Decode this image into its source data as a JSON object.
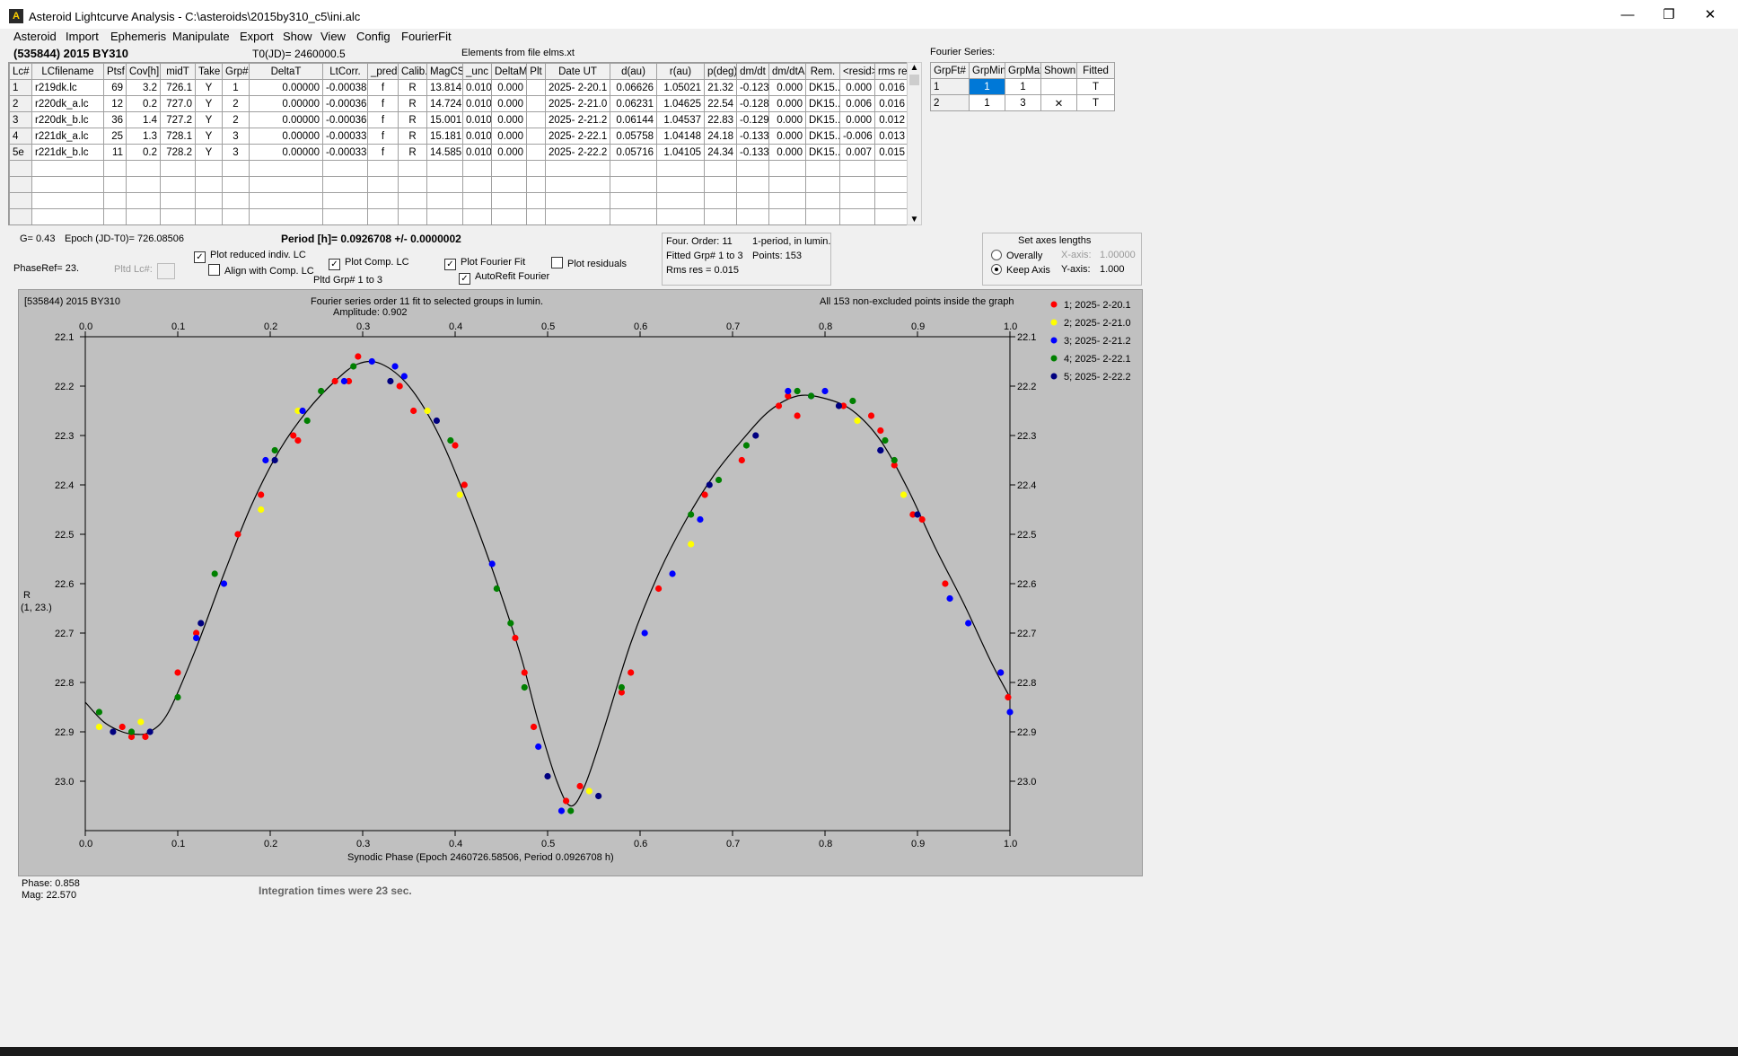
{
  "window": {
    "title": "Asteroid Lightcurve Analysis - C:\\asteroids\\2015by310_c5\\ini.alc",
    "minimize": "—",
    "restore": "❐",
    "close": "✕"
  },
  "menu": [
    "Asteroid",
    "Import",
    "Ephemeris",
    "Manipulate",
    "Export",
    "Show",
    "View",
    "Config",
    "FourierFit"
  ],
  "header": {
    "object": "(535844) 2015 BY310",
    "t0": "T0(JD)= 2460000.5",
    "elements": "Elements from file elms.xt",
    "fourier_series_label": "Fourier Series:"
  },
  "lc_table": {
    "columns": [
      "Lc#",
      "LCfilename",
      "Ptsf",
      "Cov[h]",
      "midT",
      "Take",
      "Grp#",
      "DeltaT",
      "LtCorr.",
      "_pred",
      "Calib.",
      "MagCS",
      "_unc",
      "DeltaM",
      "Plt",
      "Date UT",
      "d(au)",
      "r(au)",
      "p(deg)",
      "dm/dt",
      "dm/dtA",
      "Rem.",
      "<resid>",
      "rms res"
    ],
    "rows": [
      [
        "1",
        "r219dk.lc",
        "69",
        "3.2",
        "726.1",
        "Y",
        "1",
        "0.00000",
        "-0.00038",
        "f",
        "R",
        "13.814",
        "0.010",
        "0.000",
        "",
        "2025- 2-20.1",
        "0.06626",
        "1.05021",
        "21.32",
        "-0.123",
        "0.000",
        "DK15..",
        "0.000",
        "0.016"
      ],
      [
        "2",
        "r220dk_a.lc",
        "12",
        "0.2",
        "727.0",
        "Y",
        "2",
        "0.00000",
        "-0.00036",
        "f",
        "R",
        "14.724",
        "0.010",
        "0.000",
        "",
        "2025- 2-21.0",
        "0.06231",
        "1.04625",
        "22.54",
        "-0.128",
        "0.000",
        "DK15..",
        "0.006",
        "0.016"
      ],
      [
        "3",
        "r220dk_b.lc",
        "36",
        "1.4",
        "727.2",
        "Y",
        "2",
        "0.00000",
        "-0.00036",
        "f",
        "R",
        "15.001",
        "0.010",
        "0.000",
        "",
        "2025- 2-21.2",
        "0.06144",
        "1.04537",
        "22.83",
        "-0.129",
        "0.000",
        "DK15..",
        "0.000",
        "0.012"
      ],
      [
        "4",
        "r221dk_a.lc",
        "25",
        "1.3",
        "728.1",
        "Y",
        "3",
        "0.00000",
        "-0.00033",
        "f",
        "R",
        "15.181",
        "0.010",
        "0.000",
        "",
        "2025- 2-22.1",
        "0.05758",
        "1.04148",
        "24.18",
        "-0.133",
        "0.000",
        "DK15..",
        "-0.006",
        "0.013"
      ],
      [
        "5e",
        "r221dk_b.lc",
        "11",
        "0.2",
        "728.2",
        "Y",
        "3",
        "0.00000",
        "-0.00033",
        "f",
        "R",
        "14.585",
        "0.010",
        "0.000",
        "",
        "2025- 2-22.2",
        "0.05716",
        "1.04105",
        "24.34",
        "-0.133",
        "0.000",
        "DK15..",
        "0.007",
        "0.015"
      ]
    ]
  },
  "fourier_table": {
    "columns": [
      "GrpFt#",
      "GrpMin",
      "GrpMax",
      "Shown",
      "Fitted"
    ],
    "rows": [
      [
        "1",
        "1",
        "1",
        "",
        "T"
      ],
      [
        "2",
        "1",
        "3",
        "✕",
        "T"
      ]
    ]
  },
  "controls": {
    "g": "G= 0.43",
    "epoch": "Epoch (JD-T0)= 726.08506",
    "period": "Period [h]= 0.0926708 +/- 0.0000002",
    "phaseref": "PhaseRef= 23.",
    "pltd_lc": "Pltd Lc#:",
    "plot_reduced": "Plot reduced indiv. LC",
    "align_comp": "Align with Comp. LC",
    "plot_comp": "Plot Comp. LC",
    "pltd_grp": "Pltd Grp#  1   to   3",
    "plot_fourier": "Plot Fourier Fit",
    "autorefit": "AutoRefit Fourier",
    "plot_residuals": "Plot residuals",
    "check_mark": "✓"
  },
  "fit_info": {
    "order": "Four. Order: 11",
    "period_mode": "1-period, in lumin.",
    "fitted_grp": "Fitted Grp# 1 to 3",
    "points": "Points: 153",
    "rms": "Rms res     = 0.015"
  },
  "axes_box": {
    "title": "Set axes lengths",
    "overally": "Overally",
    "keep_axis": "Keep Axis",
    "xaxis_label": "X-axis:",
    "xaxis_value": "1.00000",
    "yaxis_label": "Y-axis:",
    "yaxis_value": "1.000"
  },
  "plot": {
    "object": "[535844) 2015 BY310",
    "fit_title": "Fourier series order 11 fit to selected groups in lumin.",
    "amplitude": "Amplitude: 0.902",
    "points_note": "All 153 non-excluded points inside the graph",
    "ylabel_1": "R",
    "ylabel_2": "(1, 23.)"
  },
  "status": {
    "phase": "Phase:   0.858",
    "mag": "Mag:     22.570",
    "integration": "Integration times were 23 sec."
  },
  "chart_data": {
    "type": "scatter",
    "title": "Fourier series order 11 fit to selected groups in lumin.",
    "xlabel": "Synodic Phase (Epoch 2460726.58506, Period 0.0926708 h)",
    "ylabel": "R",
    "xlim": [
      0,
      1
    ],
    "ylim": [
      23.1,
      22.1
    ],
    "y_inverted": true,
    "grid": false,
    "legend_position": "right",
    "xticks": [
      "0.0",
      "0.1",
      "0.2",
      "0.3",
      "0.4",
      "0.5",
      "0.6",
      "0.7",
      "0.8",
      "0.9",
      "1.0"
    ],
    "yticks": [
      "22.1",
      "22.2",
      "22.3",
      "22.4",
      "22.5",
      "22.6",
      "22.7",
      "22.8",
      "22.9",
      "23.0"
    ],
    "fit_curve": {
      "x": [
        0,
        0.02,
        0.04,
        0.055,
        0.07,
        0.09,
        0.12,
        0.15,
        0.18,
        0.21,
        0.24,
        0.27,
        0.295,
        0.32,
        0.35,
        0.38,
        0.41,
        0.44,
        0.47,
        0.49,
        0.51,
        0.525,
        0.54,
        0.56,
        0.59,
        0.62,
        0.65,
        0.68,
        0.71,
        0.74,
        0.77,
        0.8,
        0.83,
        0.86,
        0.89,
        0.92,
        0.95,
        0.98,
        1.0
      ],
      "y": [
        22.84,
        22.88,
        22.9,
        22.905,
        22.9,
        22.86,
        22.73,
        22.58,
        22.44,
        22.33,
        22.25,
        22.19,
        22.155,
        22.155,
        22.2,
        22.29,
        22.42,
        22.57,
        22.74,
        22.88,
        23.0,
        23.05,
        23.01,
        22.9,
        22.72,
        22.58,
        22.47,
        22.38,
        22.31,
        22.25,
        22.22,
        22.225,
        22.25,
        22.31,
        22.41,
        22.53,
        22.64,
        22.76,
        22.83
      ]
    },
    "series": [
      {
        "name": "1; 2025- 2-20.1",
        "color": "#ff0000",
        "points": [
          [
            0.04,
            22.89
          ],
          [
            0.05,
            22.91
          ],
          [
            0.065,
            22.91
          ],
          [
            0.1,
            22.78
          ],
          [
            0.12,
            22.7
          ],
          [
            0.165,
            22.5
          ],
          [
            0.19,
            22.42
          ],
          [
            0.225,
            22.3
          ],
          [
            0.23,
            22.31
          ],
          [
            0.27,
            22.19
          ],
          [
            0.285,
            22.19
          ],
          [
            0.295,
            22.14
          ],
          [
            0.34,
            22.2
          ],
          [
            0.355,
            22.25
          ],
          [
            0.4,
            22.32
          ],
          [
            0.41,
            22.4
          ],
          [
            0.465,
            22.71
          ],
          [
            0.475,
            22.78
          ],
          [
            0.485,
            22.89
          ],
          [
            0.52,
            23.04
          ],
          [
            0.535,
            23.01
          ],
          [
            0.58,
            22.82
          ],
          [
            0.59,
            22.78
          ],
          [
            0.62,
            22.61
          ],
          [
            0.67,
            22.42
          ],
          [
            0.71,
            22.35
          ],
          [
            0.75,
            22.24
          ],
          [
            0.76,
            22.22
          ],
          [
            0.77,
            22.26
          ],
          [
            0.82,
            22.24
          ],
          [
            0.85,
            22.26
          ],
          [
            0.86,
            22.29
          ],
          [
            0.875,
            22.36
          ],
          [
            0.895,
            22.46
          ],
          [
            0.905,
            22.47
          ],
          [
            0.93,
            22.6
          ],
          [
            0.99,
            22.78
          ],
          [
            0.998,
            22.83
          ]
        ]
      },
      {
        "name": "2; 2025- 2-21.0",
        "color": "#ffff00",
        "points": [
          [
            0.015,
            22.89
          ],
          [
            0.06,
            22.88
          ],
          [
            0.19,
            22.45
          ],
          [
            0.23,
            22.25
          ],
          [
            0.37,
            22.25
          ],
          [
            0.405,
            22.42
          ],
          [
            0.545,
            23.02
          ],
          [
            0.655,
            22.52
          ],
          [
            0.835,
            22.27
          ],
          [
            0.885,
            22.42
          ]
        ]
      },
      {
        "name": "3; 2025- 2-21.2",
        "color": "#0000ff",
        "points": [
          [
            0.12,
            22.71
          ],
          [
            0.15,
            22.6
          ],
          [
            0.195,
            22.35
          ],
          [
            0.235,
            22.25
          ],
          [
            0.28,
            22.19
          ],
          [
            0.31,
            22.15
          ],
          [
            0.335,
            22.16
          ],
          [
            0.345,
            22.18
          ],
          [
            0.44,
            22.56
          ],
          [
            0.49,
            22.93
          ],
          [
            0.515,
            23.06
          ],
          [
            0.605,
            22.7
          ],
          [
            0.635,
            22.58
          ],
          [
            0.665,
            22.47
          ],
          [
            0.76,
            22.21
          ],
          [
            0.785,
            22.22
          ],
          [
            0.8,
            22.21
          ],
          [
            0.86,
            22.33
          ],
          [
            0.935,
            22.63
          ],
          [
            0.955,
            22.68
          ],
          [
            0.99,
            22.78
          ],
          [
            1.0,
            22.86
          ]
        ]
      },
      {
        "name": "4; 2025- 2-22.1",
        "color": "#008000",
        "points": [
          [
            0.015,
            22.86
          ],
          [
            0.05,
            22.9
          ],
          [
            0.1,
            22.83
          ],
          [
            0.14,
            22.58
          ],
          [
            0.205,
            22.33
          ],
          [
            0.24,
            22.27
          ],
          [
            0.255,
            22.21
          ],
          [
            0.29,
            22.16
          ],
          [
            0.395,
            22.31
          ],
          [
            0.445,
            22.61
          ],
          [
            0.46,
            22.68
          ],
          [
            0.475,
            22.81
          ],
          [
            0.525,
            23.06
          ],
          [
            0.58,
            22.81
          ],
          [
            0.655,
            22.46
          ],
          [
            0.685,
            22.39
          ],
          [
            0.715,
            22.32
          ],
          [
            0.77,
            22.21
          ],
          [
            0.785,
            22.22
          ],
          [
            0.83,
            22.23
          ],
          [
            0.865,
            22.31
          ],
          [
            0.875,
            22.35
          ]
        ]
      },
      {
        "name": "5; 2025- 2-22.2",
        "color": "#000080",
        "points": [
          [
            0.03,
            22.9
          ],
          [
            0.07,
            22.9
          ],
          [
            0.125,
            22.68
          ],
          [
            0.205,
            22.35
          ],
          [
            0.33,
            22.19
          ],
          [
            0.38,
            22.27
          ],
          [
            0.5,
            22.99
          ],
          [
            0.555,
            23.03
          ],
          [
            0.675,
            22.4
          ],
          [
            0.725,
            22.3
          ],
          [
            0.815,
            22.24
          ],
          [
            0.86,
            22.33
          ],
          [
            0.9,
            22.46
          ]
        ]
      }
    ]
  }
}
